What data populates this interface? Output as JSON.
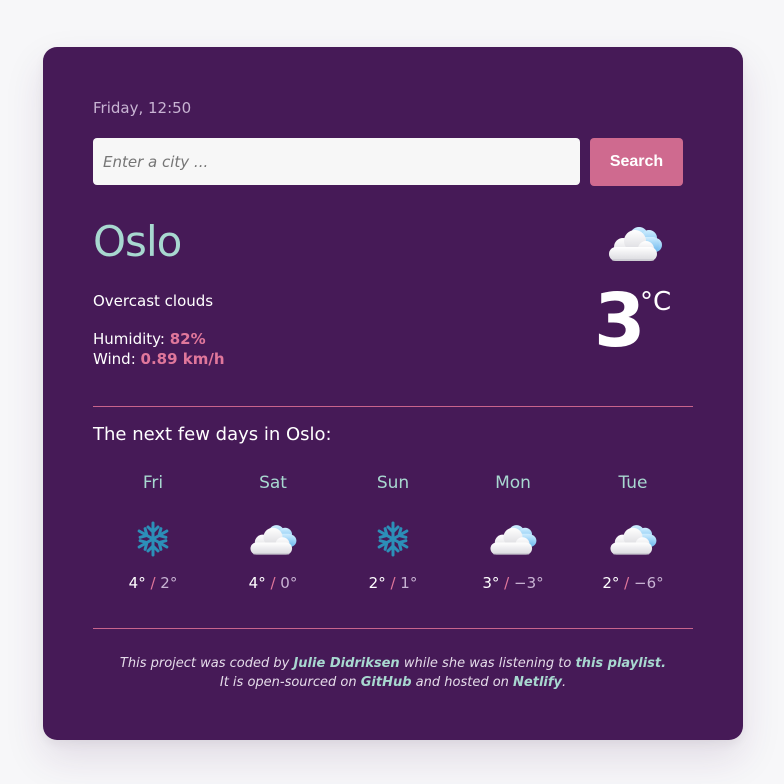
{
  "header": {
    "datetime": "Friday, 12:50"
  },
  "search": {
    "placeholder": "Enter a city ...",
    "value": "",
    "button_label": "Search"
  },
  "current": {
    "city": "Oslo",
    "description": "Overcast clouds",
    "humidity_label": "Humidity: ",
    "humidity_value": "82%",
    "wind_label": "Wind: ",
    "wind_value": "0.89 km/h",
    "temperature": "3",
    "unit": "°C",
    "icon": "cloud-icon"
  },
  "forecast": {
    "title": "The next few days in Oslo:",
    "days": [
      {
        "day": "Fri",
        "icon": "snowflake-icon",
        "max": "4°",
        "separator": " / ",
        "min": "2°"
      },
      {
        "day": "Sat",
        "icon": "cloud-icon",
        "max": "4°",
        "separator": " / ",
        "min": "0°"
      },
      {
        "day": "Sun",
        "icon": "snowflake-icon",
        "max": "2°",
        "separator": " / ",
        "min": "1°"
      },
      {
        "day": "Mon",
        "icon": "cloud-icon",
        "max": "3°",
        "separator": " / ",
        "min": "−3°"
      },
      {
        "day": "Tue",
        "icon": "cloud-icon",
        "max": "2°",
        "separator": " / ",
        "min": "−6°"
      }
    ]
  },
  "footer": {
    "line1_a": "This project was coded by ",
    "author": "Julie Didriksen",
    "line1_b": " while she was listening to ",
    "playlist": "this playlist.",
    "line2_a": "It is open-sourced on ",
    "github": "GitHub",
    "line2_b": " and hosted on ",
    "netlify": "Netlify",
    "line2_c": "."
  },
  "colors": {
    "card_background": "#461a57",
    "accent_pink": "#cf6a8f",
    "accent_mint": "#a8d8d0",
    "page_background": "#f7f7f9"
  }
}
